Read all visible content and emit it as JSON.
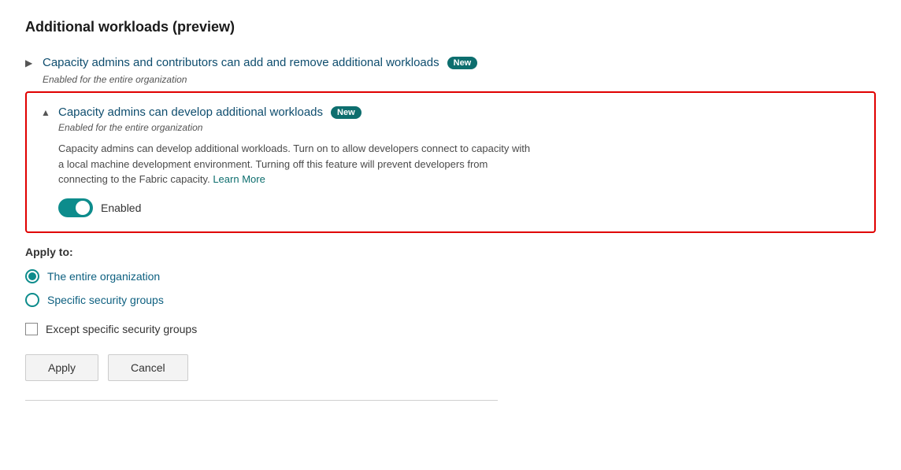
{
  "page": {
    "title": "Additional workloads (preview)"
  },
  "section1": {
    "chevron": "▶",
    "title": "Capacity admins and contributors can add and remove additional workloads",
    "badge": "New",
    "subtitle": "Enabled for the entire organization"
  },
  "section2": {
    "chevron": "▲",
    "title": "Capacity admins can develop additional workloads",
    "badge": "New",
    "subtitle": "Enabled for the entire organization",
    "description_part1": "Capacity admins can develop additional workloads. Turn on to allow developers connect to capacity with a local machine development environment. Turning off this feature will prevent developers from connecting to the Fabric capacity.",
    "learn_more_label": "Learn More",
    "toggle_label": "Enabled"
  },
  "apply_to": {
    "label": "Apply to:",
    "options": [
      {
        "id": "entire-org",
        "label": "The entire organization",
        "checked": true
      },
      {
        "id": "specific-groups",
        "label": "Specific security groups",
        "checked": false
      }
    ],
    "checkbox_label": "Except specific security groups"
  },
  "buttons": {
    "apply_label": "Apply",
    "cancel_label": "Cancel"
  }
}
